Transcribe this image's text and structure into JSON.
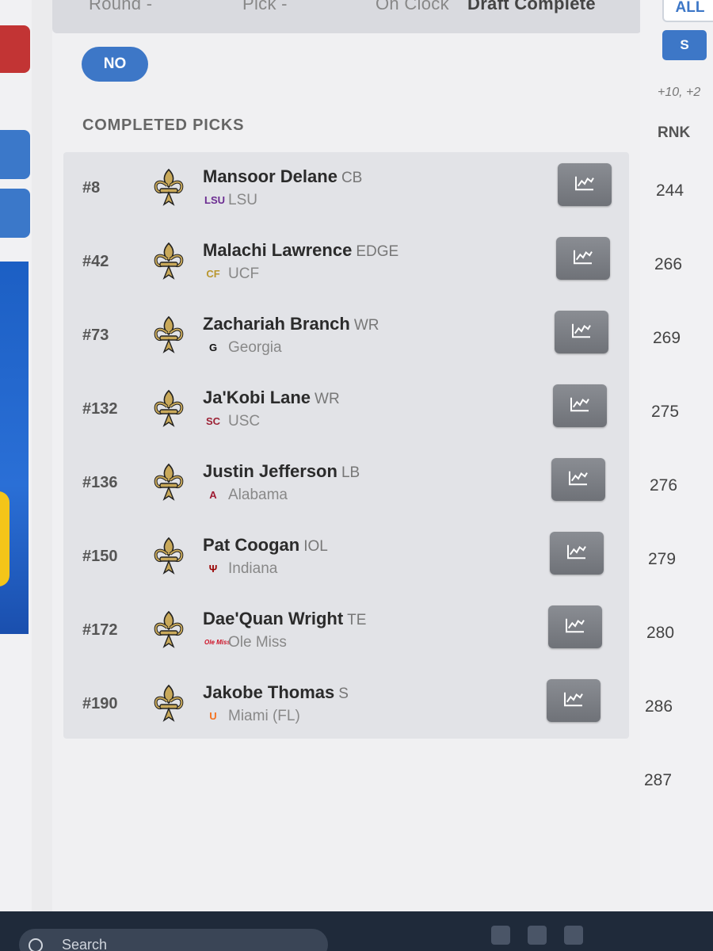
{
  "header": {
    "round_label": "Round -",
    "pick_label": "Pick -",
    "on_clock_label": "On Clock",
    "status": "Draft Complete"
  },
  "no_button_label": "NO",
  "section_title": "COMPLETED PICKS",
  "picks": [
    {
      "pick": "#8",
      "name": "Mansoor Delane",
      "pos": "CB",
      "school_abbr": "LSU",
      "school": "LSU",
      "school_color": "#6b2c91",
      "rank": "244"
    },
    {
      "pick": "#42",
      "name": "Malachi Lawrence",
      "pos": "EDGE",
      "school_abbr": "CF",
      "school": "UCF",
      "school_color": "#b8962e",
      "rank": "266"
    },
    {
      "pick": "#73",
      "name": "Zachariah Branch",
      "pos": "WR",
      "school_abbr": "G",
      "school": "Georgia",
      "school_color": "#111111",
      "rank": "269"
    },
    {
      "pick": "#132",
      "name": "Ja'Kobi Lane",
      "pos": "WR",
      "school_abbr": "SC",
      "school": "USC",
      "school_color": "#9d2235",
      "rank": "275"
    },
    {
      "pick": "#136",
      "name": "Justin Jefferson",
      "pos": "LB",
      "school_abbr": "A",
      "school": "Alabama",
      "school_color": "#9e1b32",
      "rank": "276"
    },
    {
      "pick": "#150",
      "name": "Pat Coogan",
      "pos": "IOL",
      "school_abbr": "Ψ",
      "school": "Indiana",
      "school_color": "#990000",
      "rank": "279"
    },
    {
      "pick": "#172",
      "name": "Dae'Quan Wright",
      "pos": "TE",
      "school_abbr": "Ole Miss",
      "school": "Ole Miss",
      "school_color": "#ce1126",
      "rank": "280"
    },
    {
      "pick": "#190",
      "name": "Jakobe Thomas",
      "pos": "S",
      "school_abbr": "U",
      "school": "Miami (FL)",
      "school_color": "#f47321",
      "rank": "286"
    }
  ],
  "right_panel": {
    "all_label": "ALL",
    "s_label": "S",
    "plus_text": "+10, +2",
    "rnk_header": "RNK",
    "extra_rank": "287"
  },
  "taskbar": {
    "search_label": "Search"
  },
  "colors": {
    "accent_blue": "#3d77c7",
    "saints_gold": "#c9a95a",
    "chart_button": "#7b7e84"
  }
}
